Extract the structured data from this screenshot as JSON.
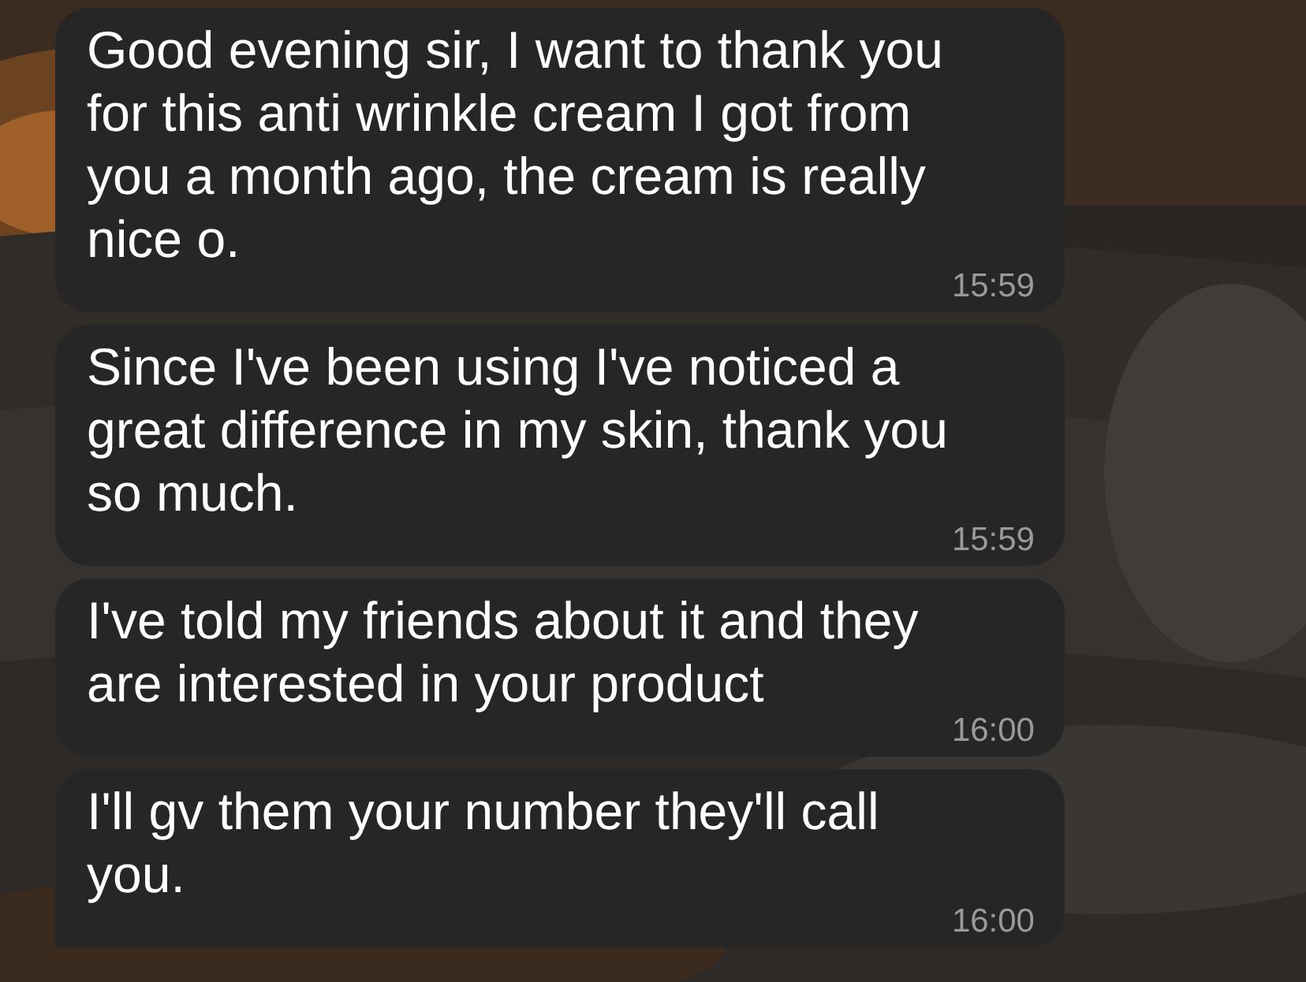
{
  "messages": [
    {
      "text": "Good evening sir, I want to thank you for this anti wrinkle cream I got from you a month ago, the cream is really nice o.",
      "time": "15:59"
    },
    {
      "text": "Since I've been using I've noticed a great difference in my skin, thank you so much.",
      "time": "15:59"
    },
    {
      "text": "I've told my friends about it and they are interested in your product",
      "time": "16:00"
    },
    {
      "text": "I'll gv them your number they'll call you.",
      "time": "16:00"
    }
  ]
}
